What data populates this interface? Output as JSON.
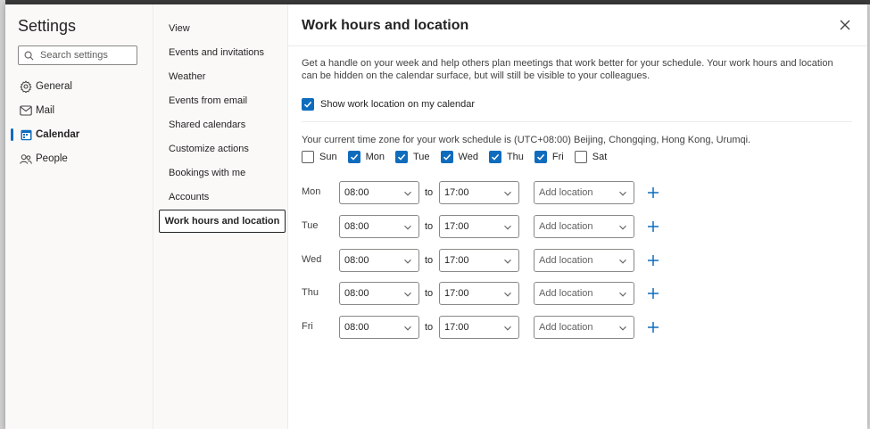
{
  "colors": {
    "accent": "#0f6cbd",
    "text": "#242424",
    "muted": "#616161"
  },
  "nav": {
    "title": "Settings",
    "search_placeholder": "Search settings",
    "items": [
      {
        "label": "General",
        "icon": "gear-icon"
      },
      {
        "label": "Mail",
        "icon": "mail-icon"
      },
      {
        "label": "Calendar",
        "icon": "calendar-icon",
        "active": true
      },
      {
        "label": "People",
        "icon": "people-icon"
      }
    ]
  },
  "subnav": {
    "items": [
      {
        "label": "View"
      },
      {
        "label": "Events and invitations"
      },
      {
        "label": "Weather"
      },
      {
        "label": "Events from email"
      },
      {
        "label": "Shared calendars"
      },
      {
        "label": "Customize actions"
      },
      {
        "label": "Bookings with me"
      },
      {
        "label": "Accounts"
      },
      {
        "label": "Work hours and location",
        "active": true
      }
    ]
  },
  "content": {
    "title": "Work hours and location",
    "description": "Get a handle on your week and help others plan meetings that work better for your schedule. Your work hours and location can be hidden on the calendar surface, but will still be visible to your colleagues.",
    "show_location": {
      "label": "Show work location on my calendar",
      "checked": true
    },
    "timezone_text": "Your current time zone for your work schedule is (UTC+08:00) Beijing, Chongqing, Hong Kong, Urumqi.",
    "days": [
      {
        "label": "Sun",
        "checked": false
      },
      {
        "label": "Mon",
        "checked": true
      },
      {
        "label": "Tue",
        "checked": true
      },
      {
        "label": "Wed",
        "checked": true
      },
      {
        "label": "Thu",
        "checked": true
      },
      {
        "label": "Fri",
        "checked": true
      },
      {
        "label": "Sat",
        "checked": false
      }
    ],
    "to_label": "to",
    "location_placeholder": "Add location",
    "schedule": [
      {
        "day": "Mon",
        "start": "08:00",
        "end": "17:00"
      },
      {
        "day": "Tue",
        "start": "08:00",
        "end": "17:00"
      },
      {
        "day": "Wed",
        "start": "08:00",
        "end": "17:00"
      },
      {
        "day": "Thu",
        "start": "08:00",
        "end": "17:00"
      },
      {
        "day": "Fri",
        "start": "08:00",
        "end": "17:00"
      }
    ]
  }
}
